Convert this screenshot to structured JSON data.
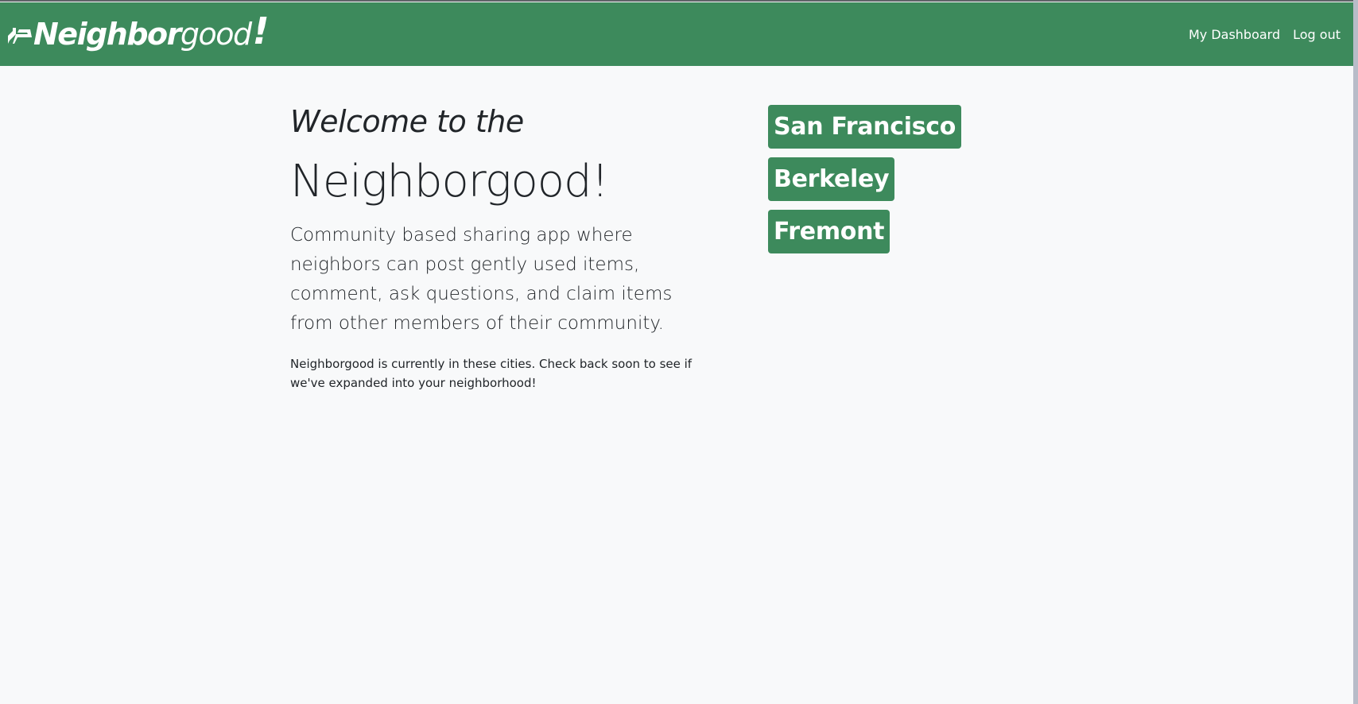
{
  "brand": {
    "strong": "Neighbor",
    "light": "good",
    "exclaim": "!"
  },
  "nav": {
    "dashboard": "My Dashboard",
    "logout": "Log out"
  },
  "intro": {
    "welcome": "Welcome to the",
    "title": "Neighborgood!",
    "lead": "Community based sharing app where neighbors can post gently used items, comment, ask questions, and claim items from other members of their community.",
    "note": "Neighborgood is currently in these cities. Check back soon to see if we've expanded into your neighborhood!"
  },
  "cities": [
    {
      "label": "San Francisco"
    },
    {
      "label": "Berkeley"
    },
    {
      "label": "Fremont"
    }
  ],
  "colors": {
    "brand_green": "#3d8a5c",
    "background": "#f8f9fa",
    "text": "#212529"
  }
}
